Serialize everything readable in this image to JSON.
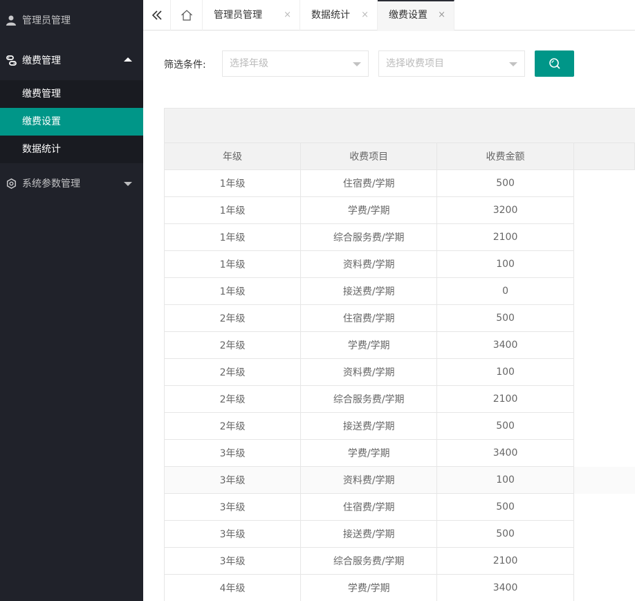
{
  "sidebar": {
    "items": [
      {
        "label": "管理员管理",
        "icon": "user-icon"
      },
      {
        "label": "缴费管理",
        "icon": "link-icon",
        "expanded": true,
        "children": [
          {
            "label": "缴费管理"
          },
          {
            "label": "缴费设置",
            "active": true
          },
          {
            "label": "数据统计"
          }
        ]
      },
      {
        "label": "系统参数管理",
        "icon": "gear-icon"
      }
    ]
  },
  "tabs": {
    "items": [
      {
        "label": "管理员管理",
        "close": "×"
      },
      {
        "label": "数据统计",
        "close": "×"
      },
      {
        "label": "缴费设置",
        "close": "×",
        "active": true
      }
    ],
    "prefix_glyph": "&#xe6; "
  },
  "filter": {
    "label": "筛选条件:",
    "grade_placeholder": "选择年级",
    "item_placeholder": "选择收费项目"
  },
  "colors": {
    "accent": "#009688",
    "sidebar_bg": "#20222a",
    "subnav_bg": "#191b21"
  },
  "table": {
    "columns": [
      "年级",
      "收费项目",
      "收费金额"
    ],
    "rows": [
      [
        "1年级",
        "住宿费/学期",
        "500"
      ],
      [
        "1年级",
        "学费/学期",
        "3200"
      ],
      [
        "1年级",
        "综合服务费/学期",
        "2100"
      ],
      [
        "1年级",
        "资料费/学期",
        "100"
      ],
      [
        "1年级",
        "接送费/学期",
        "0"
      ],
      [
        "2年级",
        "住宿费/学期",
        "500"
      ],
      [
        "2年级",
        "学费/学期",
        "3400"
      ],
      [
        "2年级",
        "资料费/学期",
        "100"
      ],
      [
        "2年级",
        "综合服务费/学期",
        "2100"
      ],
      [
        "2年级",
        "接送费/学期",
        "500"
      ],
      [
        "3年级",
        "学费/学期",
        "3400"
      ],
      [
        "3年级",
        "资料费/学期",
        "100"
      ],
      [
        "3年级",
        "住宿费/学期",
        "500"
      ],
      [
        "3年级",
        "接送费/学期",
        "500"
      ],
      [
        "3年级",
        "综合服务费/学期",
        "2100"
      ],
      [
        "4年级",
        "学费/学期",
        "3400"
      ]
    ]
  }
}
